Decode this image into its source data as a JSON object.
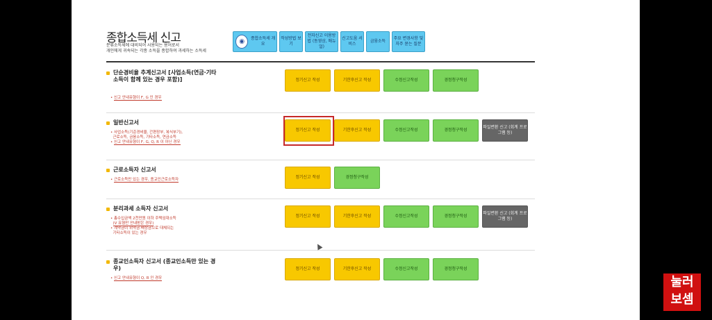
{
  "header": {
    "title": "종합소득세 신고",
    "subtitle_line1": "분류소득세에 대비되어 사용되는 용어로서",
    "subtitle_line2": "개인에게 귀속되는 각종 소득을 종합하여 과세하는 소득세"
  },
  "topnav": [
    {
      "label": "종합소득세 개요",
      "icon": "tax-emblem-icon"
    },
    {
      "label": "작성방법 보기"
    },
    {
      "label": "전자신고 이용방법 (동영상, 매뉴얼)"
    },
    {
      "label": "신고도움 서비스"
    },
    {
      "label": "금융소득"
    },
    {
      "label": "주요 변경사항 및 자주 묻는 질문"
    }
  ],
  "rows": [
    {
      "title": "단순경비율 추계신고서 [사업소득(연금·기타소득이 함께 있는 경우 포함)]",
      "notes": [
        "신고 안내유형이 F, G 인 경우"
      ],
      "buttons": [
        {
          "label": "정기신고 작성",
          "color": "yellow"
        },
        {
          "label": "기한후신고 작성",
          "color": "yellow"
        },
        {
          "label": "수정신고작성",
          "color": "green"
        },
        {
          "label": "경정청구작성",
          "color": "green"
        }
      ]
    },
    {
      "title": "일반신고서",
      "notes": [
        "사업소득(기준경비율, 간편장부, 복식부기),",
        "근로소득, 금융소득, 기타소득, 연금소득",
        "신고 안내유형이 F, G, Q, R 이 아닌 경우"
      ],
      "buttons": [
        {
          "label": "정기신고 작성",
          "color": "yellow"
        },
        {
          "label": "기한후신고 작성",
          "color": "yellow"
        },
        {
          "label": "수정신고작성",
          "color": "green"
        },
        {
          "label": "경정청구작성",
          "color": "green"
        },
        {
          "label": "파일변환 신고 (회계 프로그램 등)",
          "color": "gray"
        }
      ]
    },
    {
      "title": "근로소득자 신고서",
      "notes": [
        "근로소득만 있는 경우, 종교인근로소득자"
      ],
      "buttons": [
        {
          "label": "정기신고 작성",
          "color": "yellow"
        },
        {
          "label": "경정청구작성",
          "color": "green"
        }
      ]
    },
    {
      "title": "분리과세 소득자 신고서",
      "notes": [
        "총수입금액 2천만원 이하 주택임대소득",
        "(V 유형만 안내받은 경우)",
        "계약금이 위약금·배상금으로 대체되는",
        "기타소득이 있는 경우"
      ],
      "buttons": [
        {
          "label": "정기신고 작성",
          "color": "yellow"
        },
        {
          "label": "기한후신고 작성",
          "color": "yellow"
        },
        {
          "label": "수정신고작성",
          "color": "green"
        },
        {
          "label": "경정청구작성",
          "color": "green"
        },
        {
          "label": "파일변환 신고 (회계 프로그램 등)",
          "color": "gray"
        }
      ]
    },
    {
      "title": "종교인소득자 신고서 (종교인소득만 있는 경우)",
      "notes": [
        "신고 안내유형이 Q, R 인 경우"
      ],
      "buttons": [
        {
          "label": "정기신고 작성",
          "color": "yellow"
        },
        {
          "label": "기한후신고 작성",
          "color": "yellow"
        },
        {
          "label": "수정신고작성",
          "color": "green"
        },
        {
          "label": "경정청구작성",
          "color": "green"
        }
      ]
    }
  ],
  "watermark": {
    "line1": "눌러",
    "line2": "보셈"
  }
}
